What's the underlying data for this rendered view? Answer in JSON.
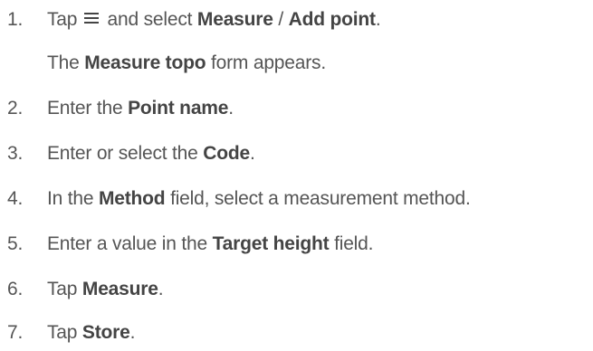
{
  "steps": [
    {
      "number": "1.",
      "pre": "Tap",
      "icon": "menu-icon",
      "mid": "and select",
      "bold1": "Measure",
      "sep": "/",
      "bold2": "Add point",
      "post": "."
    },
    {
      "note_pre": "The",
      "note_bold": "Measure topo",
      "note_post": "form appears."
    },
    {
      "number": "2.",
      "pre": "Enter the",
      "bold": "Point name",
      "post": "."
    },
    {
      "number": "3.",
      "pre": "Enter or select the",
      "bold": "Code",
      "post": "."
    },
    {
      "number": "4.",
      "pre": "In the",
      "bold": "Method",
      "post": "field, select a measurement method."
    },
    {
      "number": "5.",
      "pre": "Enter a value in the",
      "bold": "Target height",
      "post": "field."
    },
    {
      "number": "6.",
      "pre": "Tap",
      "bold": "Measure",
      "post": "."
    },
    {
      "number": "7.",
      "pre": "Tap",
      "bold": "Store",
      "post": "."
    }
  ]
}
